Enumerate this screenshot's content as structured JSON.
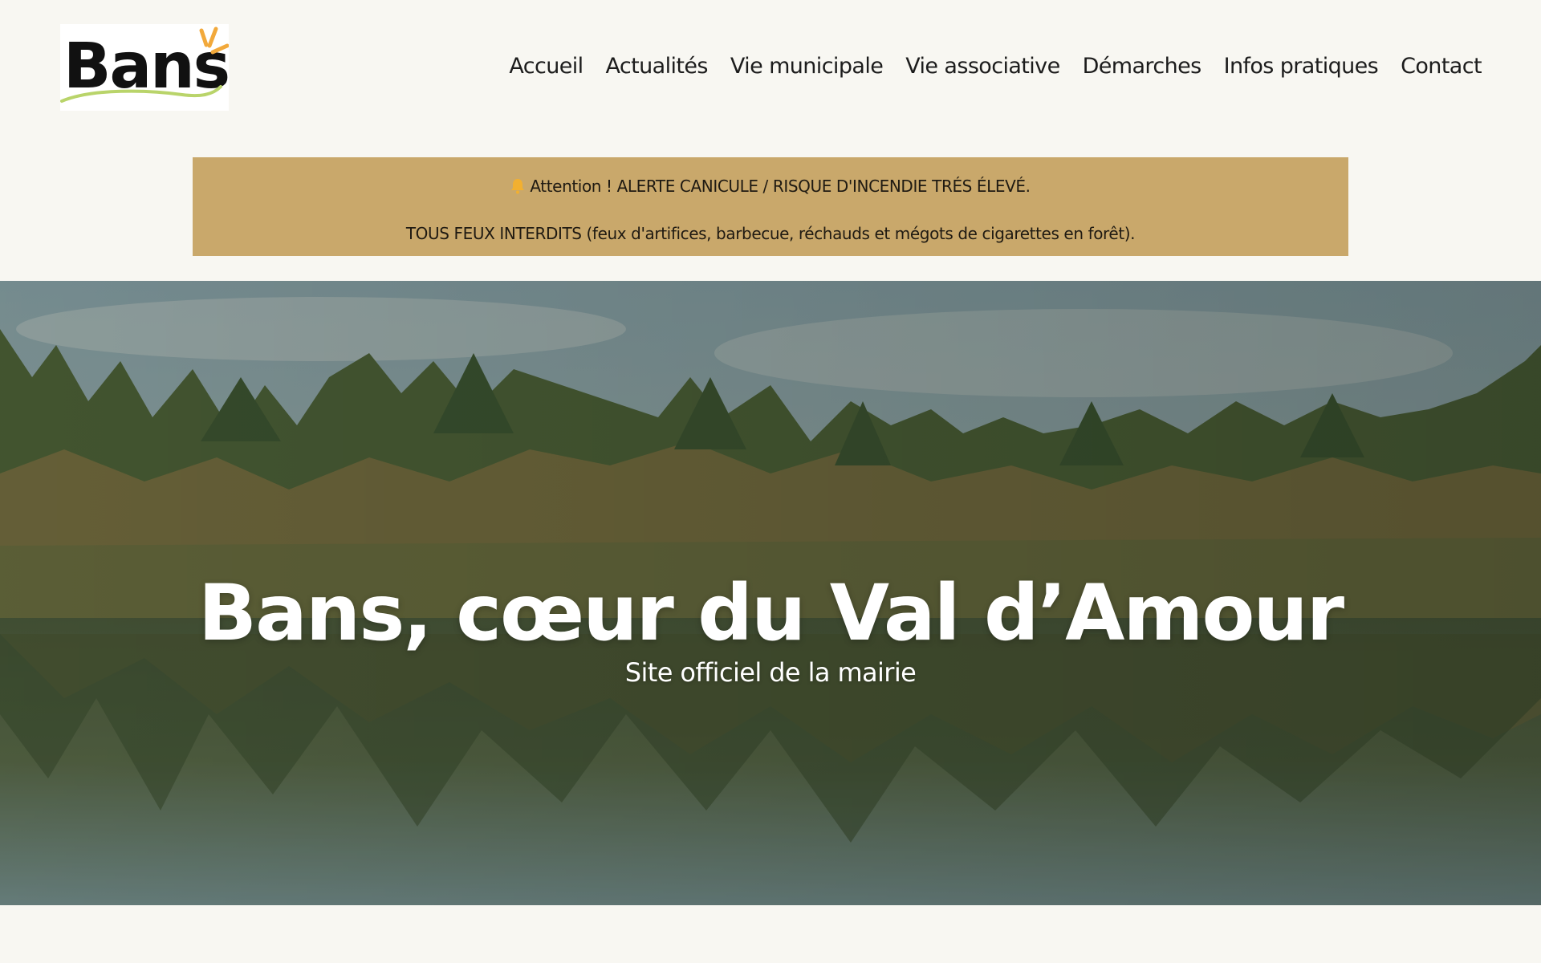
{
  "site": {
    "logo_text": "Bans"
  },
  "nav": {
    "items": [
      {
        "label": "Accueil"
      },
      {
        "label": "Actualités"
      },
      {
        "label": "Vie municipale"
      },
      {
        "label": "Vie associative"
      },
      {
        "label": "Démarches"
      },
      {
        "label": "Infos pratiques"
      },
      {
        "label": "Contact"
      }
    ]
  },
  "alert": {
    "icon": "bell-icon",
    "line1": "Attention ! ALERTE CANICULE / RISQUE D'INCENDIE TRÉS ÉLEVÉ.",
    "line2": "TOUS FEUX INTERDITS (feux d'artifices, barbecue, réchauds et mégots de cigarettes en forêt).",
    "background_color": "#c9a86b"
  },
  "hero": {
    "title": "Bans, cœur du Val d’Amour",
    "subtitle": "Site officiel de la mairie"
  },
  "colors": {
    "page_background": "#f8f7f2",
    "text": "#1c1c1c",
    "logo_accent_orange": "#f2a93b",
    "logo_accent_green": "#b9d46a"
  }
}
